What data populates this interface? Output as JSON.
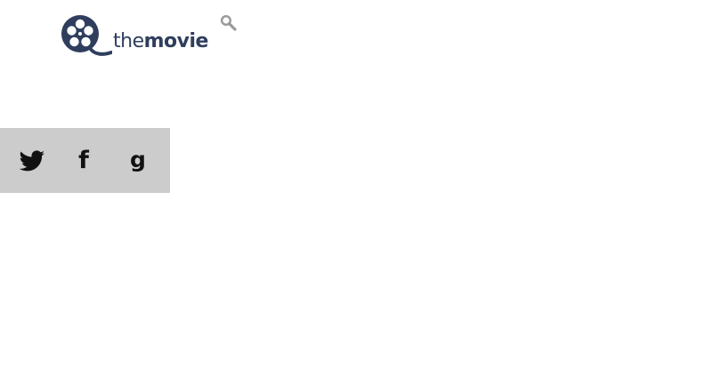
{
  "header": {
    "logo": {
      "text_light": "the",
      "text_bold": "movie",
      "icon": "film-reel-icon",
      "color": "#2f3e5d"
    },
    "search": {
      "icon": "search-icon",
      "color": "#999999"
    }
  },
  "social": {
    "background": "#cccccc",
    "items": [
      {
        "icon": "twitter-icon",
        "glyph": ""
      },
      {
        "icon": "facebook-icon",
        "glyph": "f"
      },
      {
        "icon": "google-icon",
        "glyph": "g"
      }
    ]
  }
}
